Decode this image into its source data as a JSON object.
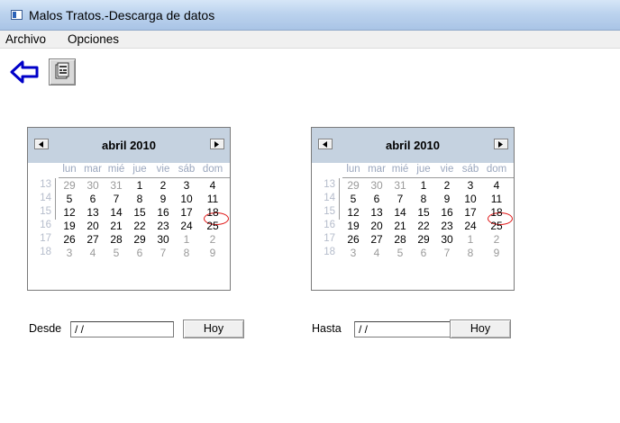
{
  "window": {
    "title": "Malos Tratos.-Descarga de datos"
  },
  "menu": [
    {
      "label": "Archivo"
    },
    {
      "label": "Opciones"
    }
  ],
  "toolbar": {
    "back_icon": "back-arrow-icon",
    "form_icon": "form-icon"
  },
  "calendars": [
    {
      "month": "abril 2010",
      "weekdays": [
        "lun",
        "mar",
        "mié",
        "jue",
        "vie",
        "sáb",
        "dom"
      ],
      "weeks": [
        {
          "num": "13",
          "days": [
            "29",
            "30",
            "31",
            "1",
            "2",
            "3",
            "4"
          ]
        },
        {
          "num": "14",
          "days": [
            "5",
            "6",
            "7",
            "8",
            "9",
            "10",
            "11"
          ]
        },
        {
          "num": "15",
          "days": [
            "12",
            "13",
            "14",
            "15",
            "16",
            "17",
            "18"
          ]
        },
        {
          "num": "16",
          "days": [
            "19",
            "20",
            "21",
            "22",
            "23",
            "24",
            "25"
          ]
        },
        {
          "num": "17",
          "days": [
            "26",
            "27",
            "28",
            "29",
            "30",
            "1",
            "2"
          ]
        },
        {
          "num": "18",
          "days": [
            "3",
            "4",
            "5",
            "6",
            "7",
            "8",
            "9"
          ]
        }
      ],
      "today": "18"
    },
    {
      "month": "abril 2010",
      "weekdays": [
        "lun",
        "mar",
        "mié",
        "jue",
        "vie",
        "sáb",
        "dom"
      ],
      "weeks": [
        {
          "num": "13",
          "days": [
            "29",
            "30",
            "31",
            "1",
            "2",
            "3",
            "4"
          ]
        },
        {
          "num": "14",
          "days": [
            "5",
            "6",
            "7",
            "8",
            "9",
            "10",
            "11"
          ]
        },
        {
          "num": "15",
          "days": [
            "12",
            "13",
            "14",
            "15",
            "16",
            "17",
            "18"
          ]
        },
        {
          "num": "16",
          "days": [
            "19",
            "20",
            "21",
            "22",
            "23",
            "24",
            "25"
          ]
        },
        {
          "num": "17",
          "days": [
            "26",
            "27",
            "28",
            "29",
            "30",
            "1",
            "2"
          ]
        },
        {
          "num": "18",
          "days": [
            "3",
            "4",
            "5",
            "6",
            "7",
            "8",
            "9"
          ]
        }
      ],
      "today": "18"
    }
  ],
  "desde": {
    "label": "Desde",
    "value": "/ /",
    "button": "Hoy"
  },
  "hasta": {
    "label": "Hasta",
    "value": "/ /",
    "button": "Hoy"
  },
  "colors": {
    "today_circle": "#e01818",
    "calendar_header": "#c5d2e0",
    "dim_text": "#9aa6bd"
  }
}
